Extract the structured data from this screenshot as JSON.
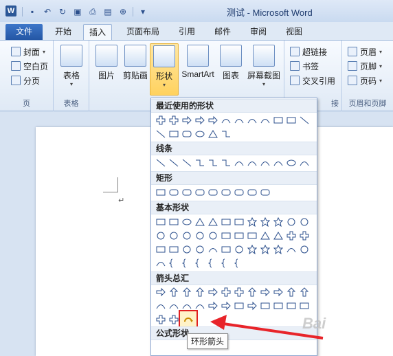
{
  "window": {
    "title": "测试 - Microsoft Word"
  },
  "qat": [
    "save-icon",
    "undo-icon",
    "redo-icon",
    "print-preview-icon",
    "print-icon",
    "open-icon",
    "attach-icon"
  ],
  "tabs": [
    {
      "label": "文件"
    },
    {
      "label": "开始"
    },
    {
      "label": "插入"
    },
    {
      "label": "页面布局"
    },
    {
      "label": "引用"
    },
    {
      "label": "邮件"
    },
    {
      "label": "审阅"
    },
    {
      "label": "视图"
    }
  ],
  "ribbon": {
    "pages": {
      "cover": "封面",
      "blank": "空白页",
      "break": "分页",
      "group": "页"
    },
    "table": {
      "label": "表格",
      "group": "表格"
    },
    "illustrations": {
      "picture": "图片",
      "clipart": "剪贴画",
      "shapes": "形状",
      "smartart": "SmartArt",
      "chart": "图表",
      "screenshot": "屏幕截图"
    },
    "links": {
      "hyperlink": "超链接",
      "bookmark": "书签",
      "crossref": "交叉引用",
      "group_tail": "接"
    },
    "header": {
      "header": "页眉",
      "footer": "页脚",
      "pagenum": "页码",
      "group": "页眉和页脚"
    }
  },
  "dropdown": {
    "sections": [
      "最近使用的形状",
      "线条",
      "矩形",
      "基本形状",
      "箭头总汇",
      "公式形状"
    ]
  },
  "tooltip": "环形箭头",
  "watermark": "Bai"
}
